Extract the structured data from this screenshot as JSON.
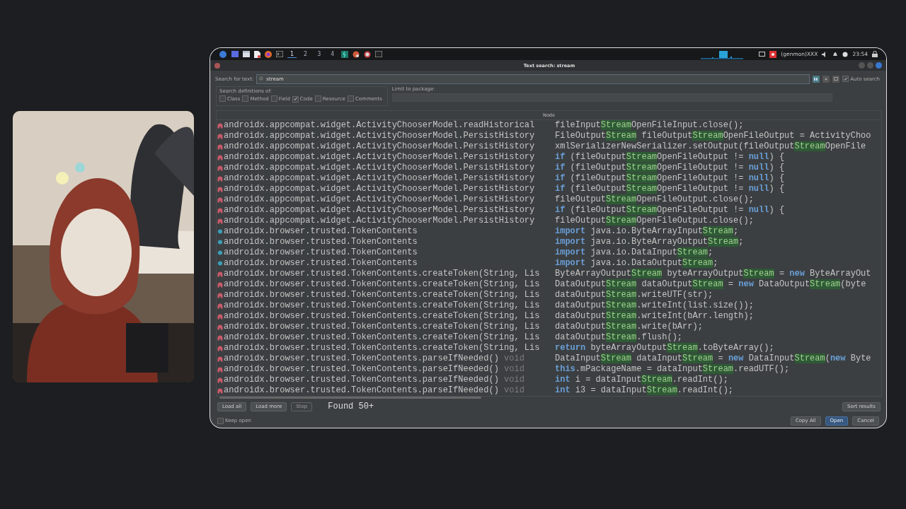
{
  "taskbar": {
    "workspaces": [
      {
        "label": "1",
        "selected": true
      },
      {
        "label": "2",
        "selected": false
      },
      {
        "label": "3",
        "selected": false
      },
      {
        "label": "4",
        "selected": false
      }
    ],
    "tray_label": "(genmon)XXX",
    "clock": "23:54"
  },
  "dialog": {
    "title": "Text search: stream",
    "search_label": "Search for text:",
    "search_value": "stream",
    "auto_search": {
      "label": "Auto search",
      "checked": true
    },
    "definitions": {
      "label": "Search definitions of:",
      "options": [
        {
          "label": "Class",
          "checked": false
        },
        {
          "label": "Method",
          "checked": false
        },
        {
          "label": "Field",
          "checked": false
        },
        {
          "label": "Code",
          "checked": true
        },
        {
          "label": "Resource",
          "checked": false
        },
        {
          "label": "Comments",
          "checked": false
        }
      ]
    },
    "package_label": "Limit to package:",
    "column": "Node",
    "results": [
      {
        "kind": "method",
        "node": "androidx.appcompat.widget.ActivityChooserModel.readHistorical",
        "code": [
          {
            "kind": "plain",
            "text": "fileInput"
          },
          {
            "kind": "match",
            "text": "Stream"
          },
          {
            "kind": "plain",
            "text": "OpenFileInput.close();"
          }
        ]
      },
      {
        "kind": "method",
        "node": "androidx.appcompat.widget.ActivityChooserModel.PersistHistory",
        "code": [
          {
            "kind": "plain",
            "text": "FileOutput"
          },
          {
            "kind": "match",
            "text": "Stream"
          },
          {
            "kind": "plain",
            "text": " fileOutput"
          },
          {
            "kind": "match",
            "text": "Stream"
          },
          {
            "kind": "plain",
            "text": "OpenFileOutput = ActivityChoo"
          }
        ]
      },
      {
        "kind": "method",
        "node": "androidx.appcompat.widget.ActivityChooserModel.PersistHistory",
        "code": [
          {
            "kind": "plain",
            "text": "xmlSerializerNewSerializer.setOutput(fileOutput"
          },
          {
            "kind": "match",
            "text": "Stream"
          },
          {
            "kind": "plain",
            "text": "OpenFile"
          }
        ]
      },
      {
        "kind": "method",
        "node": "androidx.appcompat.widget.ActivityChooserModel.PersistHistory",
        "code": [
          {
            "kind": "keyword",
            "text": "if"
          },
          {
            "kind": "plain",
            "text": " (fileOutput"
          },
          {
            "kind": "match",
            "text": "Stream"
          },
          {
            "kind": "plain",
            "text": "OpenFileOutput != "
          },
          {
            "kind": "keyword",
            "text": "null"
          },
          {
            "kind": "plain",
            "text": ") {"
          }
        ]
      },
      {
        "kind": "method",
        "node": "androidx.appcompat.widget.ActivityChooserModel.PersistHistory",
        "code": [
          {
            "kind": "keyword",
            "text": "if"
          },
          {
            "kind": "plain",
            "text": " (fileOutput"
          },
          {
            "kind": "match",
            "text": "Stream"
          },
          {
            "kind": "plain",
            "text": "OpenFileOutput != "
          },
          {
            "kind": "keyword",
            "text": "null"
          },
          {
            "kind": "plain",
            "text": ") {"
          }
        ]
      },
      {
        "kind": "method",
        "node": "androidx.appcompat.widget.ActivityChooserModel.PersistHistory",
        "code": [
          {
            "kind": "keyword",
            "text": "if"
          },
          {
            "kind": "plain",
            "text": " (fileOutput"
          },
          {
            "kind": "match",
            "text": "Stream"
          },
          {
            "kind": "plain",
            "text": "OpenFileOutput != "
          },
          {
            "kind": "keyword",
            "text": "null"
          },
          {
            "kind": "plain",
            "text": ") {"
          }
        ]
      },
      {
        "kind": "method",
        "node": "androidx.appcompat.widget.ActivityChooserModel.PersistHistory",
        "code": [
          {
            "kind": "keyword",
            "text": "if"
          },
          {
            "kind": "plain",
            "text": " (fileOutput"
          },
          {
            "kind": "match",
            "text": "Stream"
          },
          {
            "kind": "plain",
            "text": "OpenFileOutput != "
          },
          {
            "kind": "keyword",
            "text": "null"
          },
          {
            "kind": "plain",
            "text": ") {"
          }
        ]
      },
      {
        "kind": "method",
        "node": "androidx.appcompat.widget.ActivityChooserModel.PersistHistory",
        "code": [
          {
            "kind": "plain",
            "text": "fileOutput"
          },
          {
            "kind": "match",
            "text": "Stream"
          },
          {
            "kind": "plain",
            "text": "OpenFileOutput.close();"
          }
        ]
      },
      {
        "kind": "method",
        "node": "androidx.appcompat.widget.ActivityChooserModel.PersistHistory",
        "code": [
          {
            "kind": "keyword",
            "text": "if"
          },
          {
            "kind": "plain",
            "text": " (fileOutput"
          },
          {
            "kind": "match",
            "text": "Stream"
          },
          {
            "kind": "plain",
            "text": "OpenFileOutput != "
          },
          {
            "kind": "keyword",
            "text": "null"
          },
          {
            "kind": "plain",
            "text": ") {"
          }
        ]
      },
      {
        "kind": "method",
        "node": "androidx.appcompat.widget.ActivityChooserModel.PersistHistory",
        "code": [
          {
            "kind": "plain",
            "text": "fileOutput"
          },
          {
            "kind": "match",
            "text": "Stream"
          },
          {
            "kind": "plain",
            "text": "OpenFileOutput.close();"
          }
        ]
      },
      {
        "kind": "class",
        "node": "androidx.browser.trusted.TokenContents",
        "code": [
          {
            "kind": "keyword",
            "text": "import"
          },
          {
            "kind": "plain",
            "text": " java.io.ByteArrayInput"
          },
          {
            "kind": "match",
            "text": "Stream"
          },
          {
            "kind": "plain",
            "text": ";"
          }
        ]
      },
      {
        "kind": "class",
        "node": "androidx.browser.trusted.TokenContents",
        "code": [
          {
            "kind": "keyword",
            "text": "import"
          },
          {
            "kind": "plain",
            "text": " java.io.ByteArrayOutput"
          },
          {
            "kind": "match",
            "text": "Stream"
          },
          {
            "kind": "plain",
            "text": ";"
          }
        ]
      },
      {
        "kind": "class",
        "node": "androidx.browser.trusted.TokenContents",
        "code": [
          {
            "kind": "keyword",
            "text": "import"
          },
          {
            "kind": "plain",
            "text": " java.io.DataInput"
          },
          {
            "kind": "match",
            "text": "Stream"
          },
          {
            "kind": "plain",
            "text": ";"
          }
        ]
      },
      {
        "kind": "class",
        "node": "androidx.browser.trusted.TokenContents",
        "code": [
          {
            "kind": "keyword",
            "text": "import"
          },
          {
            "kind": "plain",
            "text": " java.io.DataOutput"
          },
          {
            "kind": "match",
            "text": "Stream"
          },
          {
            "kind": "plain",
            "text": ";"
          }
        ]
      },
      {
        "kind": "method",
        "node": "androidx.browser.trusted.TokenContents.createToken(String, Lis",
        "code": [
          {
            "kind": "plain",
            "text": "ByteArrayOutput"
          },
          {
            "kind": "match",
            "text": "Stream"
          },
          {
            "kind": "plain",
            "text": " byteArrayOutput"
          },
          {
            "kind": "match",
            "text": "Stream"
          },
          {
            "kind": "plain",
            "text": " = "
          },
          {
            "kind": "keyword",
            "text": "new"
          },
          {
            "kind": "plain",
            "text": " ByteArrayOut"
          }
        ]
      },
      {
        "kind": "method",
        "node": "androidx.browser.trusted.TokenContents.createToken(String, Lis",
        "code": [
          {
            "kind": "plain",
            "text": "DataOutput"
          },
          {
            "kind": "match",
            "text": "Stream"
          },
          {
            "kind": "plain",
            "text": " dataOutput"
          },
          {
            "kind": "match",
            "text": "Stream"
          },
          {
            "kind": "plain",
            "text": " = "
          },
          {
            "kind": "keyword",
            "text": "new"
          },
          {
            "kind": "plain",
            "text": " DataOutput"
          },
          {
            "kind": "match",
            "text": "Stream"
          },
          {
            "kind": "plain",
            "text": "(byte"
          }
        ]
      },
      {
        "kind": "method",
        "node": "androidx.browser.trusted.TokenContents.createToken(String, Lis",
        "code": [
          {
            "kind": "plain",
            "text": "dataOutput"
          },
          {
            "kind": "match",
            "text": "Stream"
          },
          {
            "kind": "plain",
            "text": ".writeUTF(str);"
          }
        ]
      },
      {
        "kind": "method",
        "node": "androidx.browser.trusted.TokenContents.createToken(String, Lis",
        "code": [
          {
            "kind": "plain",
            "text": "dataOutput"
          },
          {
            "kind": "match",
            "text": "Stream"
          },
          {
            "kind": "plain",
            "text": ".writeInt(list.size());"
          }
        ]
      },
      {
        "kind": "method",
        "node": "androidx.browser.trusted.TokenContents.createToken(String, Lis",
        "code": [
          {
            "kind": "plain",
            "text": "dataOutput"
          },
          {
            "kind": "match",
            "text": "Stream"
          },
          {
            "kind": "plain",
            "text": ".writeInt(bArr.length);"
          }
        ]
      },
      {
        "kind": "method",
        "node": "androidx.browser.trusted.TokenContents.createToken(String, Lis",
        "code": [
          {
            "kind": "plain",
            "text": "dataOutput"
          },
          {
            "kind": "match",
            "text": "Stream"
          },
          {
            "kind": "plain",
            "text": ".write(bArr);"
          }
        ]
      },
      {
        "kind": "method",
        "node": "androidx.browser.trusted.TokenContents.createToken(String, Lis",
        "code": [
          {
            "kind": "plain",
            "text": "dataOutput"
          },
          {
            "kind": "match",
            "text": "Stream"
          },
          {
            "kind": "plain",
            "text": ".flush();"
          }
        ]
      },
      {
        "kind": "method",
        "node": "androidx.browser.trusted.TokenContents.createToken(String, Lis",
        "code": [
          {
            "kind": "keyword",
            "text": "return"
          },
          {
            "kind": "plain",
            "text": " byteArrayOutput"
          },
          {
            "kind": "match",
            "text": "Stream"
          },
          {
            "kind": "plain",
            "text": ".toByteArray();"
          }
        ]
      },
      {
        "kind": "method",
        "node": "androidx.browser.trusted.TokenContents.parseIfNeeded()",
        "return_type": "void",
        "code": [
          {
            "kind": "plain",
            "text": "DataInput"
          },
          {
            "kind": "match",
            "text": "Stream"
          },
          {
            "kind": "plain",
            "text": " dataInput"
          },
          {
            "kind": "match",
            "text": "Stream"
          },
          {
            "kind": "plain",
            "text": " = "
          },
          {
            "kind": "keyword",
            "text": "new"
          },
          {
            "kind": "plain",
            "text": " DataInput"
          },
          {
            "kind": "match",
            "text": "Stream"
          },
          {
            "kind": "plain",
            "text": "("
          },
          {
            "kind": "keyword",
            "text": "new"
          },
          {
            "kind": "plain",
            "text": " Byte"
          }
        ]
      },
      {
        "kind": "method",
        "node": "androidx.browser.trusted.TokenContents.parseIfNeeded()",
        "return_type": "void",
        "code": [
          {
            "kind": "keyword",
            "text": "this"
          },
          {
            "kind": "plain",
            "text": ".mPackageName = dataInput"
          },
          {
            "kind": "match",
            "text": "Stream"
          },
          {
            "kind": "plain",
            "text": ".readUTF();"
          }
        ]
      },
      {
        "kind": "method",
        "node": "androidx.browser.trusted.TokenContents.parseIfNeeded()",
        "return_type": "void",
        "code": [
          {
            "kind": "keyword",
            "text": "int"
          },
          {
            "kind": "plain",
            "text": " i = dataInput"
          },
          {
            "kind": "match",
            "text": "Stream"
          },
          {
            "kind": "plain",
            "text": ".readInt();"
          }
        ]
      },
      {
        "kind": "method",
        "node": "androidx.browser.trusted.TokenContents.parseIfNeeded()",
        "return_type": "void",
        "code": [
          {
            "kind": "keyword",
            "text": "int"
          },
          {
            "kind": "plain",
            "text": " i3 = dataInput"
          },
          {
            "kind": "match",
            "text": "Stream"
          },
          {
            "kind": "plain",
            "text": ".readInt();"
          }
        ]
      }
    ],
    "action_buttons": [
      {
        "label": "Load all",
        "disabled": false
      },
      {
        "label": "Load more",
        "disabled": false
      },
      {
        "label": "Stop",
        "disabled": true
      }
    ],
    "status": "Found 50+",
    "sort_button": "Sort results",
    "keep_open": {
      "label": "Keep open",
      "checked": false
    },
    "footer_buttons": [
      {
        "label": "Copy All",
        "primary": false
      },
      {
        "label": "Open",
        "primary": true
      },
      {
        "label": "Cancel",
        "primary": false
      }
    ]
  }
}
